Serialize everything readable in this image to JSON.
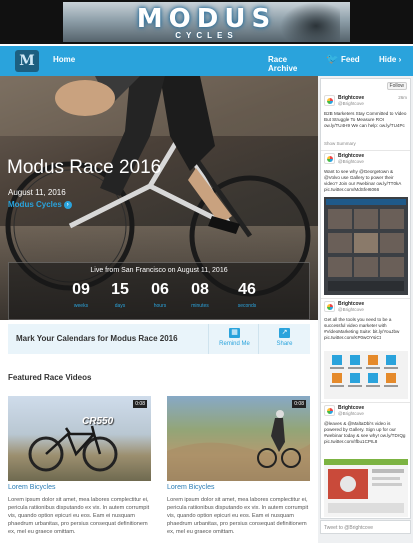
{
  "banner": {
    "logo": "MODUS",
    "logo_sub": "CYCLES"
  },
  "nav": {
    "home": "Home",
    "archive": "Race Archive",
    "logo_letter": "M"
  },
  "hero": {
    "title": "Modus Race 2016",
    "date": "August 11, 2016",
    "org": "Modus Cycles",
    "live_label": "Live from San Francisco on August 11, 2016",
    "countdown": [
      {
        "num": "09",
        "unit": "weeks"
      },
      {
        "num": "15",
        "unit": "days"
      },
      {
        "num": "06",
        "unit": "hours"
      },
      {
        "num": "08",
        "unit": "minutes"
      },
      {
        "num": "46",
        "unit": "seconds"
      }
    ]
  },
  "calendar": {
    "text": "Mark Your Calendars for Modus Race 2016",
    "remind": "Remind Me",
    "share": "Share"
  },
  "featured": {
    "title": "Featured Race Videos",
    "videos": [
      {
        "badge": "0:08",
        "brand": "CR550",
        "title": "Lorem Bicycles",
        "body": "Lorem ipsum dolor sit amet, mea labores complectitur ei, pericula ratiionibus disputando ex vix. In autem corrumpit vis, quando option epicuri eu eos. Eam ei nusquam phaedrum urbanitas, pro persius consequat definitionem ex, mel eu graece omittam."
      },
      {
        "badge": "0:08",
        "brand": "",
        "title": "Lorem Bicycles",
        "body": "Lorem ipsum dolor sit amet, mea labores complectitur ei, pericula ratiionibus disputando ex vix. In autem corrumpit vis, quando option epicuri eu eos. Eam ei nusquam phaedrum urbanitas, pro persius consequat definitionem ex, mel eu graece omittam."
      }
    ]
  },
  "feed": {
    "label": "Feed",
    "hide": "Hide",
    "follow": "Follow",
    "tweets": [
      {
        "name": "Brightcove",
        "handle": "@Brightcove",
        "time": "26m",
        "text": "B2B Marketers Stay Committed to Video But Struggle To Measure ROI ow.ly/TU4H9 We can help: ow.ly/TU4Pc",
        "foot": "Show Summary"
      },
      {
        "name": "Brightcove",
        "handle": "@Brightcove",
        "time": "",
        "text": "Want to see why @Georgetown & @Volvo use Gallery to power their video? Join our #webinar ow.ly/TT0kA pic.twitter.com/MdSfeI6066",
        "foot": ""
      },
      {
        "name": "Brightcove",
        "handle": "@Brightcove",
        "time": "",
        "text": "Get all the tools you need to be a successful video marketer with #VideoMarketing Suite: bit.ly/YouJbw pic.twitter.com/KP0wOYsiCt",
        "foot": ""
      },
      {
        "name": "Brightcove",
        "handle": "@Brightcove",
        "time": "",
        "text": "@leaves & @MaltaDbi's video is powered by Gallery. Sign up for our #webinar today & see why! ow.ly/TDrQg pic.twitter.com/Ifbu1CPIL8",
        "foot": ""
      }
    ],
    "tweet_to": "Tweet to @Brightcove"
  },
  "colors": {
    "accent": "#2aa3dc",
    "dark": "#111111"
  }
}
